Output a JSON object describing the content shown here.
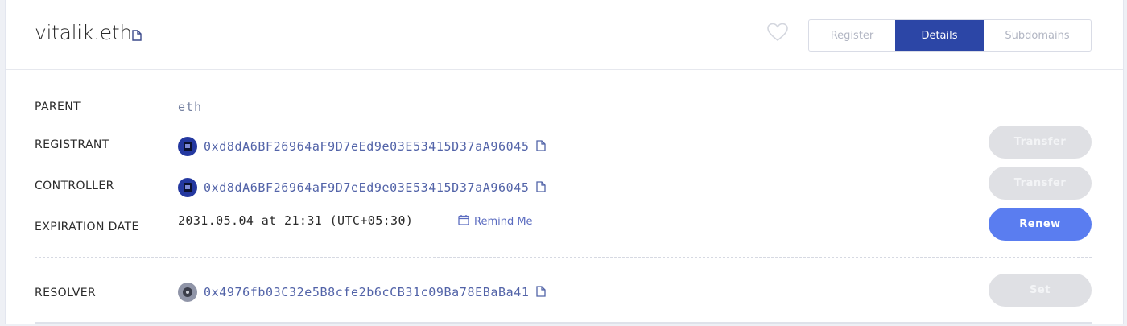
{
  "header": {
    "domain": "vitalik.eth",
    "tabs": [
      {
        "label": "Register",
        "active": false
      },
      {
        "label": "Details",
        "active": true
      },
      {
        "label": "Subdomains",
        "active": false
      }
    ]
  },
  "details": {
    "parent": {
      "label": "PARENT",
      "value": "eth"
    },
    "registrant": {
      "label": "REGISTRANT",
      "address": "0xd8dA6BF26964aF9D7eEd9e03E53415D37aA96045",
      "button": "Transfer"
    },
    "controller": {
      "label": "CONTROLLER",
      "address": "0xd8dA6BF26964aF9D7eEd9e03E53415D37aA96045",
      "button": "Transfer"
    },
    "expiration": {
      "label": "EXPIRATION DATE",
      "value": "2031.05.04 at 21:31 (UTC+05:30)",
      "remind_label": "Remind Me",
      "button": "Renew"
    },
    "resolver": {
      "label": "RESOLVER",
      "address": "0x4976fb03C32e5B8cfe2b6cCB31c09Ba78EBaBa41",
      "button": "Set"
    }
  },
  "colors": {
    "accent": "#2c46a6",
    "primary_button": "#5a7df0",
    "disabled_button": "#dfe0e4",
    "link": "#5263a8"
  },
  "icons": [
    "copy-icon",
    "heart-icon",
    "calendar-icon",
    "avatar-icon"
  ]
}
